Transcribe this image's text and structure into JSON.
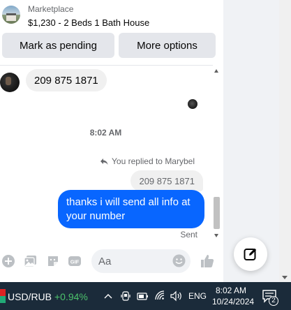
{
  "header": {
    "marketplace_label": "Marketplace",
    "listing_title": "$1,230 - 2 Beds 1 Bath House"
  },
  "actions": {
    "mark_pending": "Mark as pending",
    "more_options": "More options"
  },
  "messages": {
    "incoming_text": "209 875 1871",
    "timestamp": "8:02 AM",
    "replied_to": "You replied to Marybel",
    "quoted_text": "209 875 1871",
    "outgoing_text": "thanks i will send all info at your number",
    "status": "Sent"
  },
  "composer": {
    "placeholder": "Aa"
  },
  "taskbar": {
    "ticker_name": "USD/RUB",
    "ticker_change": "+0.94%",
    "language": "ENG",
    "time": "8:02 AM",
    "date": "10/24/2024",
    "notification_count": "2"
  },
  "colors": {
    "accent_blue": "#0866ff",
    "ticker_green": "#4cc26b",
    "taskbar_bg": "#1b2b3a"
  }
}
